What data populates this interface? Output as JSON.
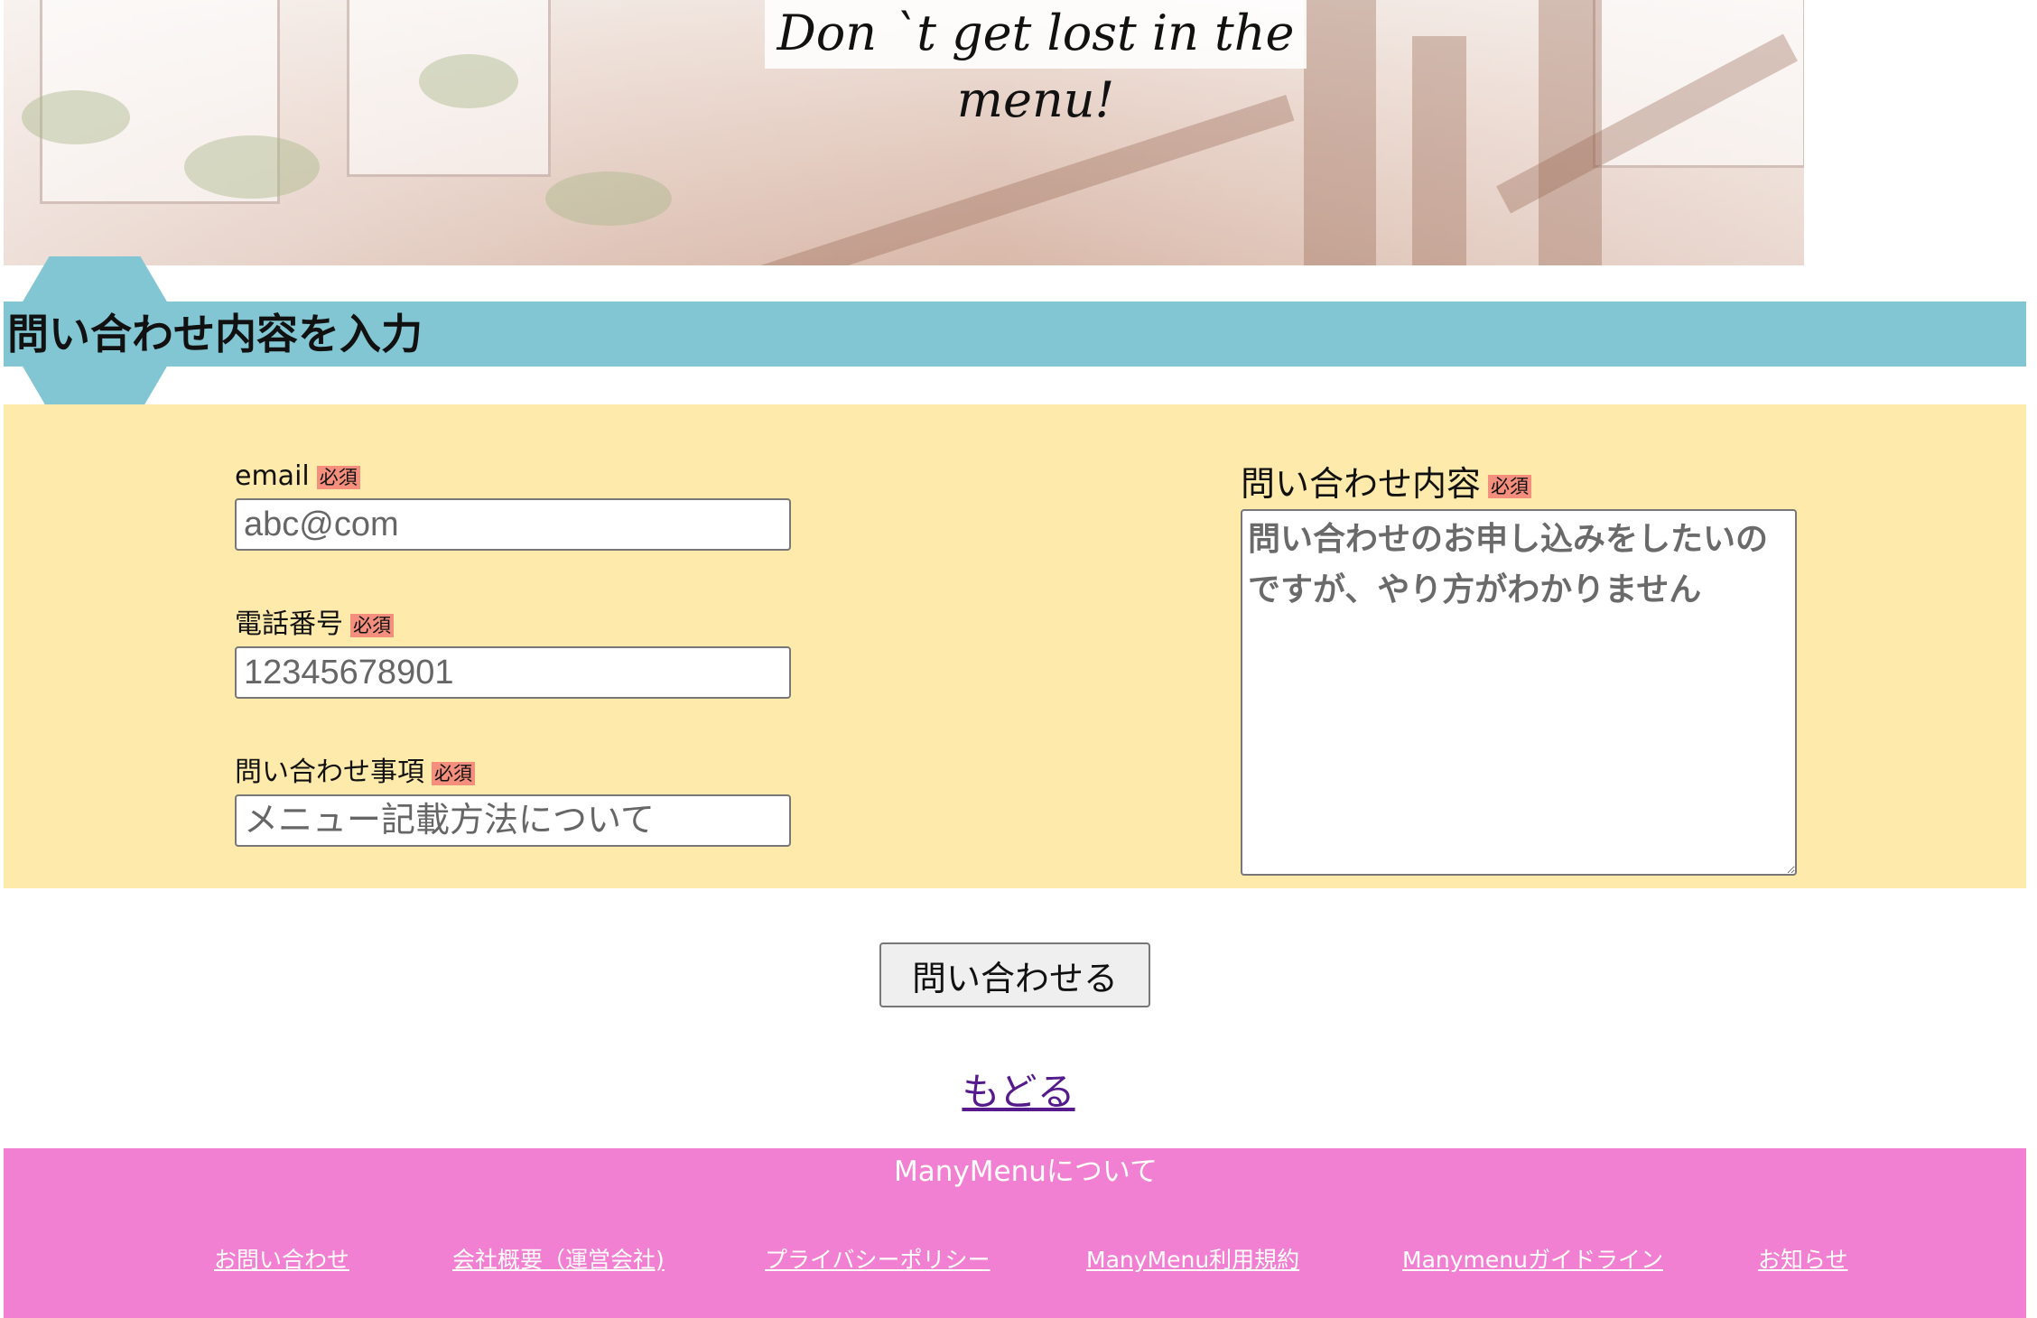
{
  "hero": {
    "title": "Don `t get lost in the menu!"
  },
  "section": {
    "title": "問い合わせ内容を入力"
  },
  "form": {
    "required_badge": "必須",
    "email": {
      "label": "email",
      "placeholder": "abc@com"
    },
    "phone": {
      "label": "電話番号",
      "placeholder": "12345678901"
    },
    "subject": {
      "label": "問い合わせ事項",
      "placeholder": "メニュー記載方法について"
    },
    "message": {
      "label": "問い合わせ内容",
      "placeholder": "問い合わせのお申し込みをしたいのですが、やり方がわかりません"
    },
    "submit_label": "問い合わせる"
  },
  "back_link": "もどる",
  "footer": {
    "title": "ManyMenuについて",
    "links": [
      "お問い合わせ",
      "会社概要（運営会社)",
      "プライバシーポリシー",
      "ManyMenu利用規約",
      "Manymenuガイドライン",
      "お知らせ"
    ]
  },
  "colors": {
    "hexagon_band": "#82c6d3",
    "form_panel": "#feeaaa",
    "required_badge": "#f38f7c",
    "footer": "#f280d2",
    "link_visited": "#551a8b"
  }
}
